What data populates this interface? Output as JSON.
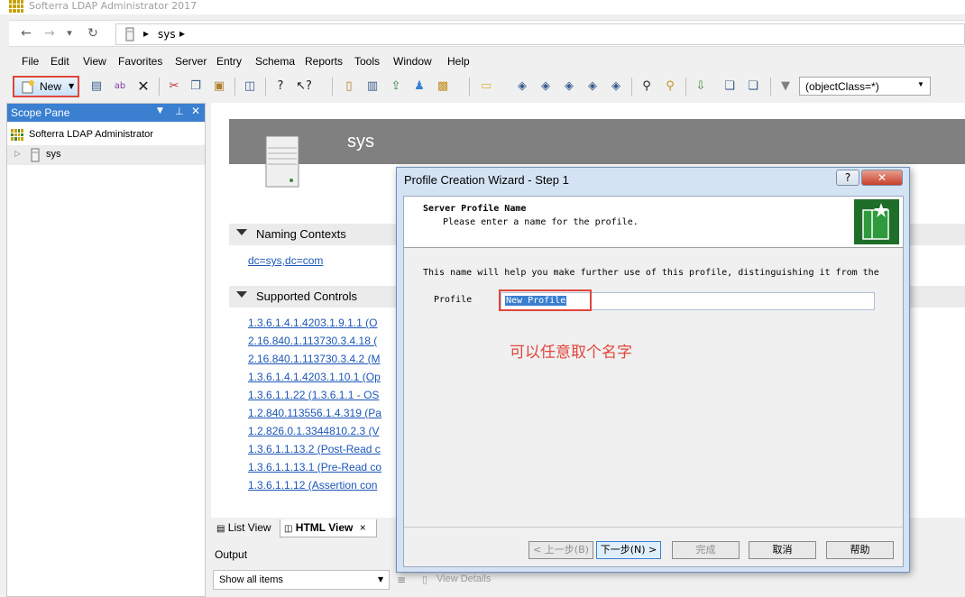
{
  "app": {
    "title": "Softerra LDAP Administrator 2017"
  },
  "nav": {
    "back": "←",
    "forward": "→",
    "dropdown": "▾",
    "refresh": "↻",
    "path_arrow": "▸",
    "path": "sys",
    "path_arrow2": "▸"
  },
  "menu": [
    "File",
    "Edit",
    "View",
    "Favorites",
    "Server",
    "Entry",
    "Schema",
    "Reports",
    "Tools",
    "Window",
    "Help"
  ],
  "toolbar": {
    "new_label": "New",
    "filter_value": "(objectClass=*)"
  },
  "scope_pane": {
    "title": "Scope Pane",
    "root": "Softerra LDAP Administrator",
    "child": "sys"
  },
  "html_view": {
    "server_name": "sys",
    "naming_contexts_title": "Naming Contexts",
    "naming_context": "dc=sys,dc=com",
    "supported_controls_title": "Supported Controls",
    "controls": [
      "1.3.6.1.4.1.4203.1.9.1.1 (O",
      "2.16.840.1.113730.3.4.18 (",
      "2.16.840.1.113730.3.4.2 (M",
      "1.3.6.1.4.1.4203.1.10.1 (Op",
      "1.3.6.1.1.22 (1.3.6.1.1 - OS",
      "1.2.840.113556.1.4.319 (Pa",
      "1.2.826.0.1.3344810.2.3 (V",
      "1.3.6.1.1.13.2 (Post-Read c",
      "1.3.6.1.1.13.1 (Pre-Read co",
      "1.3.6.1.1.12 (Assertion con"
    ]
  },
  "view_tabs": {
    "list": "List View",
    "html": "HTML View",
    "close": "×"
  },
  "output": {
    "title": "Output",
    "filter": "Show all items",
    "view_details": "View Details"
  },
  "dialog": {
    "title": "Profile Creation Wizard - Step 1",
    "help": "?",
    "close": "✕",
    "header_title": "Server Profile Name",
    "header_desc": "Please enter a name for the profile.",
    "body_text": "This name will help you make further use of this profile, distinguishing it from the",
    "profile_label": "Profile",
    "profile_value": "New Profile",
    "annotation": "可以任意取个名字",
    "btn_back": "< 上一步(B)",
    "btn_next": "下一步(N) >",
    "btn_finish": "完成",
    "btn_cancel": "取消",
    "btn_help": "帮助"
  }
}
